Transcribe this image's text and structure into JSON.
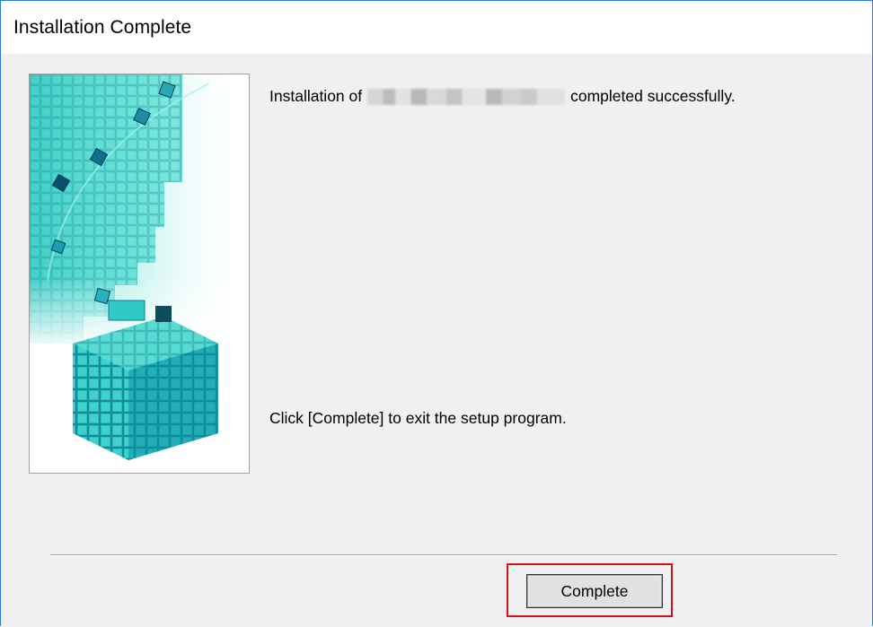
{
  "window": {
    "title": "Installation Complete"
  },
  "message": {
    "prefix": "Installation of",
    "suffix": "completed successfully."
  },
  "instruction": "Click [Complete] to exit the setup program.",
  "buttons": {
    "complete_label": "Complete"
  },
  "colors": {
    "window_border": "#2b79d8",
    "highlight_box": "#d0121b",
    "cube_accent": "#1fc9c4"
  },
  "icons": {
    "side_graphic": "cube-assembly-illustration"
  }
}
